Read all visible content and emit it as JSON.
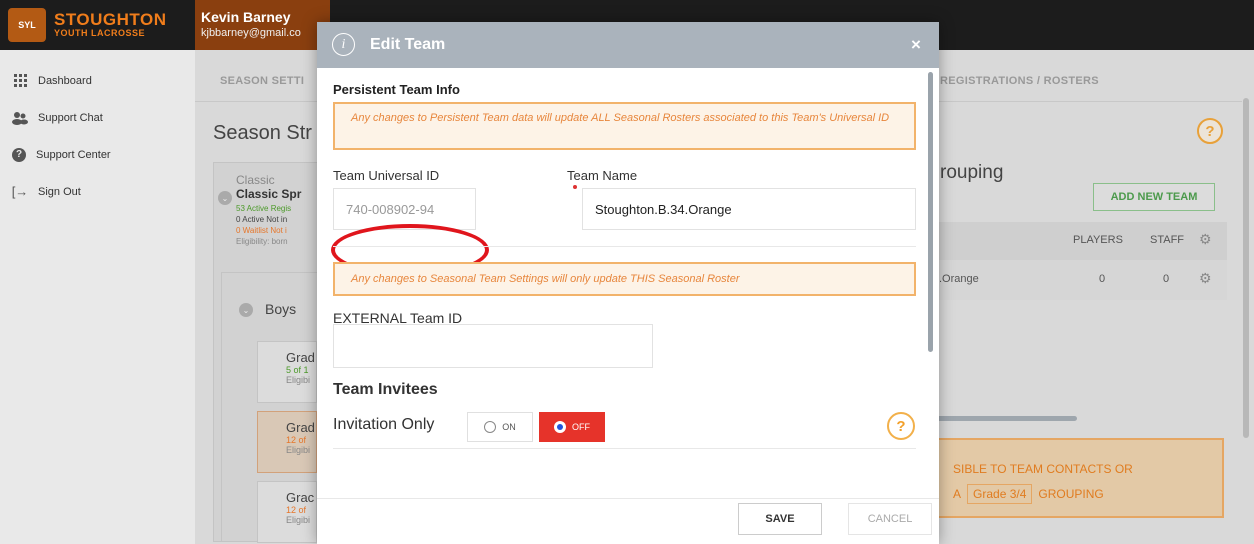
{
  "brand": {
    "name": "STOUGHTON",
    "subtitle": "YOUTH LACROSSE"
  },
  "user": {
    "name": "Kevin Barney",
    "email": "kjbbarney@gmail.co"
  },
  "sidebar": {
    "items": [
      {
        "label": "Dashboard",
        "icon": "grid-icon"
      },
      {
        "label": "Support Chat",
        "icon": "chat-users-icon"
      },
      {
        "label": "Support Center",
        "icon": "help-circle-icon"
      },
      {
        "label": "Sign Out",
        "icon": "sign-out-icon"
      }
    ]
  },
  "background": {
    "tabs": {
      "season_settings": "SEASON SETTI",
      "registrations": "REGISTRATIONS / ROSTERS"
    },
    "page_title": "Season Str",
    "help": "?",
    "program": {
      "small": "Classic",
      "name": "Classic Spr",
      "active": "53 Active Regis",
      "inactive": "0 Active Not in",
      "waitlist": "0 Waitlist Not i",
      "eligibility": "Eligibility: born"
    },
    "group": "Boys",
    "grades": [
      {
        "title": "Grad",
        "sub": "5 of 1",
        "elig": "Eligibi"
      },
      {
        "title": "Grad",
        "sub": "12 of",
        "elig": "Eligibi"
      },
      {
        "title": "Grac",
        "sub": "12 of",
        "elig": "Eligibi"
      }
    ],
    "grouping_title": "rouping",
    "add_team": "ADD NEW TEAM",
    "table": {
      "headers": {
        "players": "PLAYERS",
        "staff": "STAFF"
      },
      "row": {
        "team": ".Orange",
        "players": "0",
        "staff": "0"
      }
    },
    "banner": {
      "line1": "SIBLE TO TEAM CONTACTS OR",
      "line2_prefix": "A",
      "grade": "Grade 3/4",
      "line2_suffix": "GROUPING"
    }
  },
  "modal": {
    "title": "Edit Team",
    "close": "×",
    "persistent_section": "Persistent Team Info",
    "persistent_warning": "Any changes to Persistent Team data will update ALL Seasonal Rosters associated to this Team's Universal ID",
    "universal_id_label": "Team Universal ID",
    "universal_id_value": "740-008902-94",
    "team_name_label": "Team Name",
    "team_name_value": "Stoughton.B.34.Orange",
    "seasonal_warning": "Any changes to Seasonal Team Settings will only update THIS Seasonal Roster",
    "external_id_label": "EXTERNAL Team ID",
    "external_id_value": "",
    "invitees_title": "Team Invitees",
    "invitation_label": "Invitation Only",
    "toggle_on": "ON",
    "toggle_off": "OFF",
    "invitation_value": "OFF",
    "help": "?",
    "save": "SAVE",
    "cancel": "CANCEL"
  },
  "colors": {
    "accent": "#f07d1b",
    "danger": "#e6332a",
    "annotation": "#e0151c"
  }
}
